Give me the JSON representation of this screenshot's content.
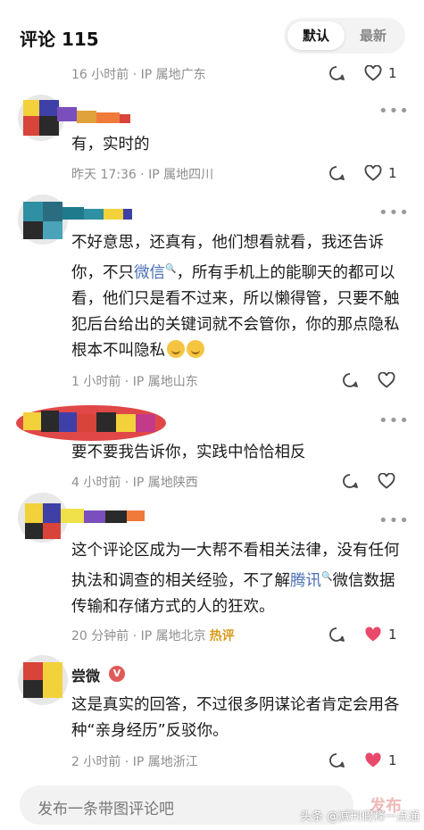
{
  "header": {
    "title": "评论 115",
    "tab_default": "默认",
    "tab_latest": "最新"
  },
  "comments": [
    {
      "meta": "16 小时前 · IP 属地广东",
      "likes": "1"
    },
    {
      "text": "有，实时的",
      "meta": "昨天 17:36 · IP 属地四川",
      "likes": "1"
    },
    {
      "text_a": "不好意思，还真有，他们想看就看，我还告诉你，不只",
      "link": "微信",
      "text_b": "，所有手机上的能聊天的都可以看，他们只是看不过来，所以懒得管，只要不触犯后台给出的关键词就不会管你，你的那点隐私根本不叫隐私",
      "meta": "1 小时前 · IP 属地山东"
    },
    {
      "text": "要不要我告诉你，实践中恰恰相反",
      "meta": "4 小时前 · IP 属地陕西"
    },
    {
      "text_a": "这个评论区成为一大帮不看相关法律，没有任何执法和调查的相关经验，不了解",
      "link": "腾讯",
      "text_b": "微信数据传输和存储方式的人的狂欢。",
      "meta": "20 分钟前 · IP 属地北京",
      "hot": "热评",
      "likes": "1"
    },
    {
      "username": "尝微",
      "text": "这是真实的回答，不过很多阴谋论者肯定会用各种“亲身经历”反驳你。",
      "meta": "2 小时前 · IP 属地浙江",
      "likes": "1"
    }
  ],
  "composer": {
    "placeholder": "发布一条带图评论吧",
    "send_label": "发布"
  },
  "watermark": "头条 @减刑假释一点通",
  "colors": {
    "like_active": "#e94a6b",
    "link": "#4a6fb5",
    "hot": "#d99a1c"
  }
}
